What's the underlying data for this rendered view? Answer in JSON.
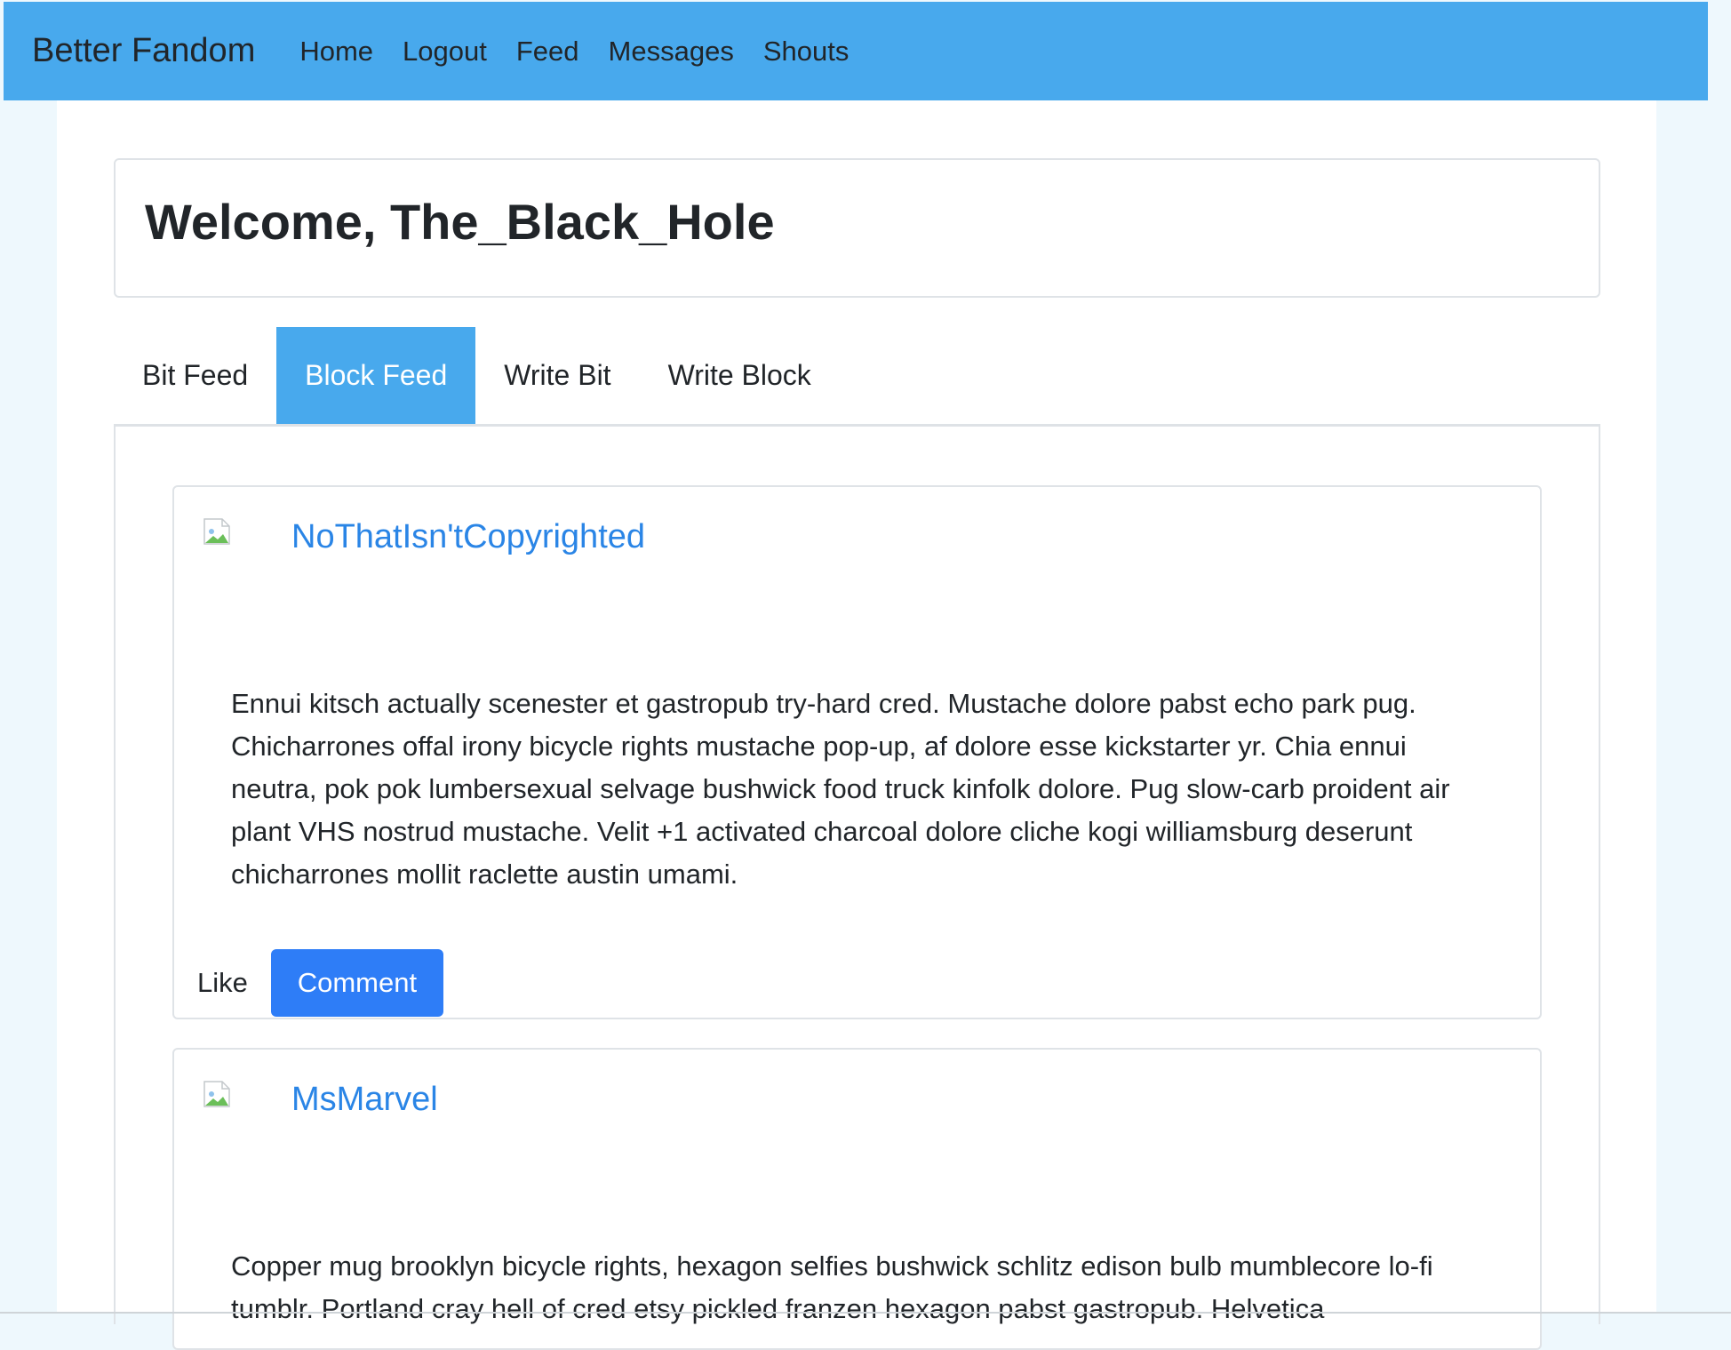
{
  "navbar": {
    "brand": "Better Fandom",
    "links": [
      "Home",
      "Logout",
      "Feed",
      "Messages",
      "Shouts"
    ]
  },
  "welcome": {
    "title": "Welcome, The_Black_Hole"
  },
  "tabs": [
    {
      "label": "Bit Feed",
      "active": false
    },
    {
      "label": "Block Feed",
      "active": true
    },
    {
      "label": "Write Bit",
      "active": false
    },
    {
      "label": "Write Block",
      "active": false
    }
  ],
  "posts": [
    {
      "username": "NoThatIsn'tCopyrighted",
      "text": "Ennui kitsch actually scenester et gastropub try-hard cred. Mustache dolore pabst echo park pug. Chicharrones offal irony bicycle rights mustache pop-up, af dolore esse kickstarter yr. Chia ennui neutra, pok pok lumbersexual selvage bushwick food truck kinfolk dolore. Pug slow-carb proident air plant VHS nostrud mustache. Velit +1 activated charcoal dolore cliche kogi williamsburg deserunt chicharrones mollit raclette austin umami.",
      "like_label": "Like",
      "comment_label": "Comment"
    },
    {
      "username": "MsMarvel",
      "text": "Copper mug brooklyn bicycle rights, hexagon selfies bushwick schlitz edison bulb mumblecore lo-fi tumblr. Portland cray hell of cred etsy pickled franzen hexagon pabst gastropub. Helvetica"
    }
  ],
  "colors": {
    "navbar": "#48a9ed",
    "active_tab": "#48a9ed",
    "link": "#2a85e6",
    "primary_button": "#2e7df7",
    "page_background": "#eef8fd"
  },
  "icons": {
    "avatar": "broken-image-icon"
  }
}
